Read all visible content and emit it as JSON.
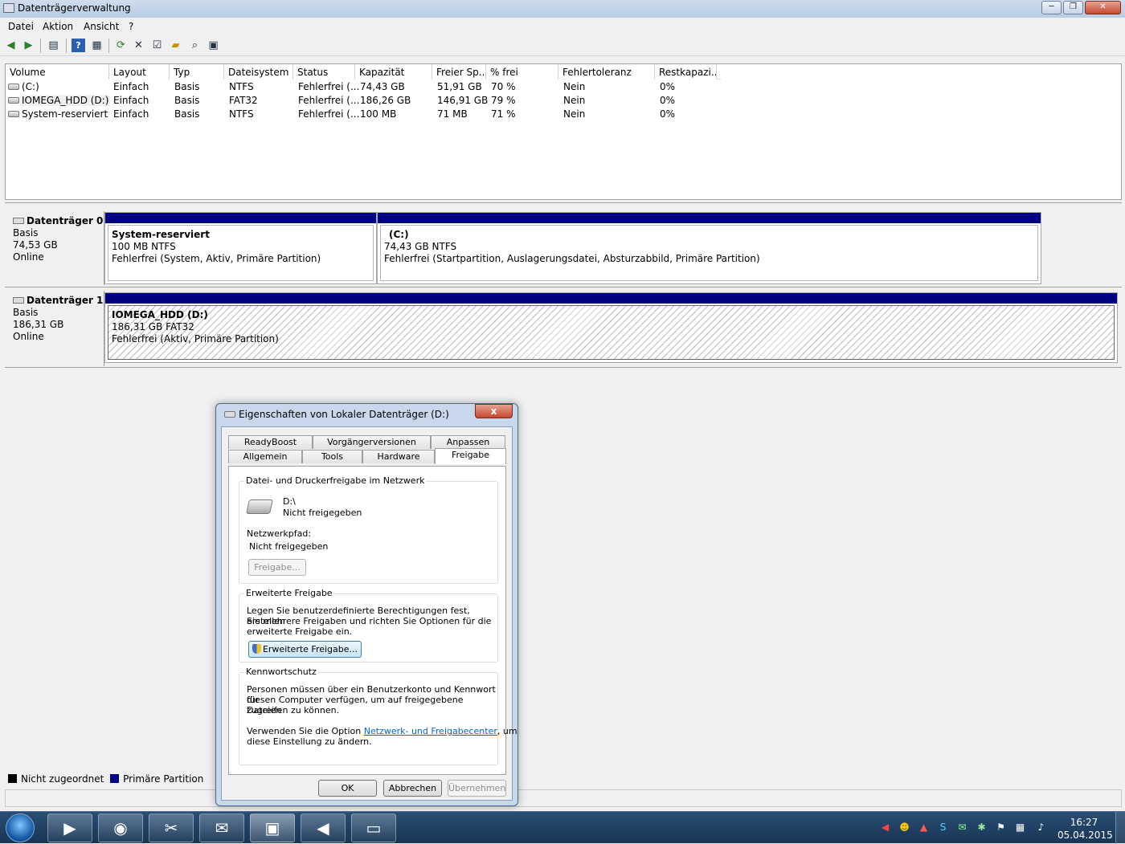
{
  "window": {
    "title": "Datenträgerverwaltung",
    "buttons": [
      "─",
      "❐",
      "✕"
    ]
  },
  "menu": [
    "Datei",
    "Aktion",
    "Ansicht",
    "?"
  ],
  "toolbar": {
    "icons": [
      "back-icon",
      "forward-icon",
      "view-icon",
      "help-icon",
      "view2-icon",
      "refresh-icon",
      "delete-icon",
      "properties-icon",
      "open-icon",
      "search-icon",
      "settings-icon"
    ]
  },
  "volumes": {
    "columns": [
      "Volume",
      "Layout",
      "Typ",
      "Dateisystem",
      "Status",
      "Kapazität",
      "Freier Sp...",
      "% frei",
      "Fehlertoleranz",
      "Restkapazi..."
    ],
    "rows": [
      [
        "(C:)",
        "Einfach",
        "Basis",
        "NTFS",
        "Fehlerfrei (...",
        "74,43 GB",
        "51,91 GB",
        "70 %",
        "Nein",
        "0%"
      ],
      [
        "IOMEGA_HDD (D:)",
        "Einfach",
        "Basis",
        "FAT32",
        "Fehlerfrei (...",
        "186,26 GB",
        "146,91 GB",
        "79 %",
        "Nein",
        "0%"
      ],
      [
        "System-reserviert",
        "Einfach",
        "Basis",
        "NTFS",
        "Fehlerfrei (...",
        "100 MB",
        "71 MB",
        "71 %",
        "Nein",
        "0%"
      ]
    ]
  },
  "disks": [
    {
      "name": "Datenträger 0",
      "type": "Basis",
      "size": "74,53 GB",
      "state": "Online",
      "partitions": [
        {
          "name": "System-reserviert",
          "size": "100 MB NTFS",
          "status": "Fehlerfrei (System, Aktiv, Primäre Partition)"
        },
        {
          "name": "(C:)",
          "size": "74,43 GB NTFS",
          "status": "Fehlerfrei (Startpartition, Auslagerungsdatei, Absturzabbild, Primäre Partition)"
        }
      ]
    },
    {
      "name": "Datenträger 1",
      "type": "Basis",
      "size": "186,31 GB",
      "state": "Online",
      "partitions": [
        {
          "name": "IOMEGA_HDD  (D:)",
          "size": "186,31 GB FAT32",
          "status": "Fehlerfrei (Aktiv, Primäre Partition)"
        }
      ]
    }
  ],
  "legend": [
    {
      "label": "Nicht zugeordnet",
      "color": "#000000"
    },
    {
      "label": "Primäre Partition",
      "color": "#000080"
    }
  ],
  "dialog": {
    "title": "Eigenschaften von Lokaler Datenträger (D:)",
    "close": "x",
    "tabs_row1": [
      "ReadyBoost",
      "Vorgängerversionen",
      "Anpassen"
    ],
    "tabs_row2": [
      "Allgemein",
      "Tools",
      "Hardware",
      "Freigabe"
    ],
    "group1": {
      "title": "Datei- und Druckerfreigabe im Netzwerk",
      "drive": "D:\\",
      "drive_state": "Nicht freigegeben",
      "path_label": "Netzwerkpfad:",
      "path_value": "Nicht freigegeben",
      "button": "Freigabe..."
    },
    "group2": {
      "title": "Erweiterte Freigabe",
      "text1": "Legen Sie benutzerdefinierte Berechtigungen fest, erstellen",
      "text2": "Sie mehrere Freigaben und richten Sie Optionen für die",
      "text3": "erweiterte Freigabe ein.",
      "button": "Erweiterte Freigabe..."
    },
    "group3": {
      "title": "Kennwortschutz",
      "text1": "Personen müssen über ein Benutzerkonto und Kennwort für",
      "text2": "diesen Computer verfügen, um auf freigegebene Dateien",
      "text3": "zugreifen zu können.",
      "text4_prefix": "Verwenden Sie die Option ",
      "text4_link": "Netzwerk- und Freigabecenter",
      "text4_suffix": ", um",
      "text5": "diese Einstellung zu ändern."
    },
    "buttons": {
      "ok": "OK",
      "cancel": "Abbrechen",
      "apply": "Übernehmen"
    }
  },
  "taskbar": {
    "apps": [
      "media-player-icon",
      "chrome-icon",
      "tools-icon",
      "mail-icon",
      "toolbox-icon",
      "speaker-icon",
      "explorer-folder-icon"
    ],
    "time": "16:27",
    "date": "05.04.2015"
  }
}
